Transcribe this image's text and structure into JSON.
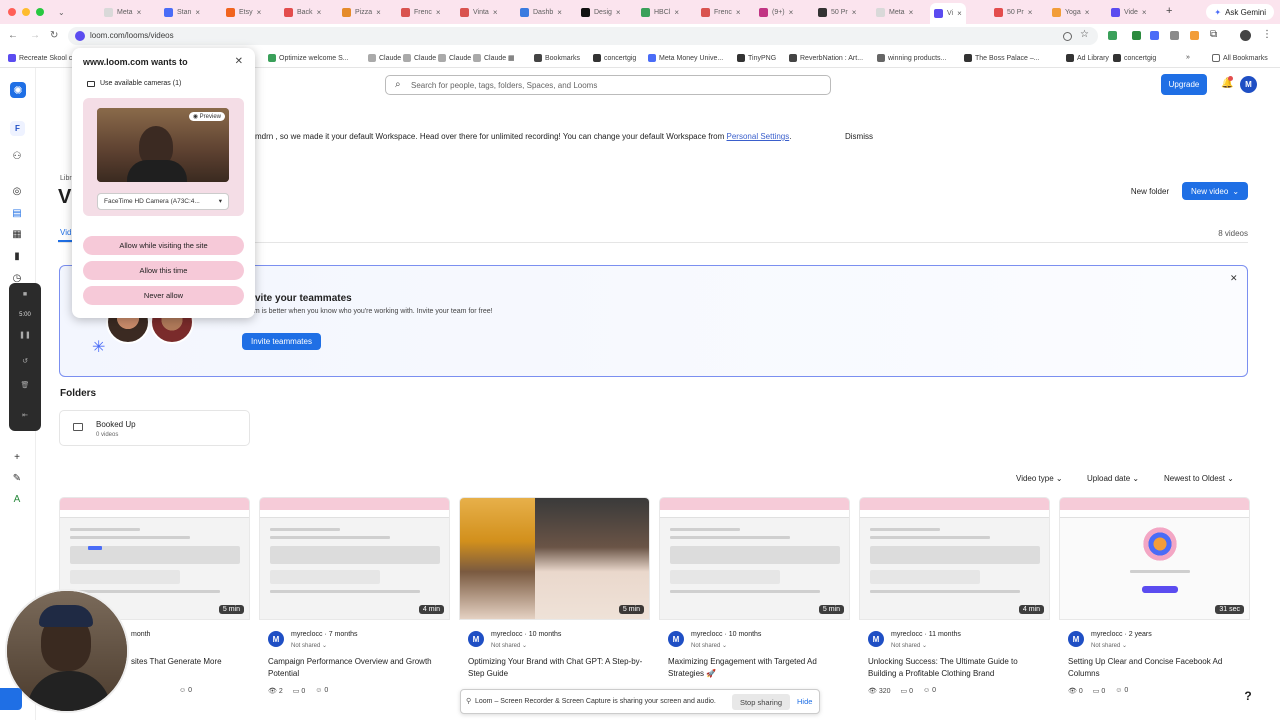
{
  "browser": {
    "tabs": [
      {
        "label": "Meta",
        "color": "#d9d9d9"
      },
      {
        "label": "Stan",
        "color": "#4a6cf7"
      },
      {
        "label": "Etsy",
        "color": "#f1641e"
      },
      {
        "label": "Back",
        "color": "#e34d4d"
      },
      {
        "label": "Pizza",
        "color": "#e58b2a"
      },
      {
        "label": "Frenc",
        "color": "#d9534f"
      },
      {
        "label": "Vinta",
        "color": "#d9534f"
      },
      {
        "label": "Dashb",
        "color": "#3a7be0"
      },
      {
        "label": "Desig",
        "color": "#111111"
      },
      {
        "label": "HBCl",
        "color": "#3aa05a"
      },
      {
        "label": "Frenc",
        "color": "#d9534f"
      },
      {
        "label": "(9+)",
        "color": "#c13584"
      },
      {
        "label": "50 Pr",
        "color": "#333333"
      },
      {
        "label": "Meta",
        "color": "#d9d9d9"
      },
      {
        "label": "Vi",
        "color": "#5b4cf0"
      },
      {
        "label": "50 Pr",
        "color": "#e34d4d"
      },
      {
        "label": "Yoga",
        "color": "#f29d38"
      },
      {
        "label": "Vide",
        "color": "#5b4cf0"
      }
    ],
    "ask_gemini": "Ask Gemini",
    "url": "loom.com/looms/videos",
    "bookmarks": [
      "Recreate Skool c...",
      "Optimize welcome S...",
      "Claude",
      "Claude",
      "Claude",
      "Claude",
      "Bookmarks",
      "concertgig",
      "Meta Money Unive...",
      "TinyPNG",
      "ReverbNation : Art...",
      "winning products...",
      "The Boss Palace –...",
      "Ad Library",
      "concertgig"
    ],
    "all_bookmarks": "All Bookmarks"
  },
  "permission": {
    "title": "www.loom.com wants to",
    "camera_line": "Use available cameras (1)",
    "preview_badge": "Preview",
    "camera_select": "FaceTime HD Camera (A73C:4...",
    "buttons": [
      "Allow while visiting the site",
      "Allow this time",
      "Never allow"
    ]
  },
  "app": {
    "search_placeholder": "Search for people, tags, folders, Spaces, and Looms",
    "upgrade": "Upgrade",
    "user_initial": "M",
    "workspace_initial": "F",
    "banner": {
      "text_a": "mdrn , so we made it your default Workspace. Head over there for unlimited recording! You can change your default Workspace from",
      "link": "Personal Settings",
      "text_b": ".",
      "dismiss": "Dismiss"
    },
    "library_crumb": "Libr",
    "page_title": "V",
    "tab_videos": "Vid",
    "new_folder": "New folder",
    "new_video": "New video",
    "video_count": "8 videos",
    "invite": {
      "title": "vite your teammates",
      "subtitle": "om is better when you know who you're working with. Invite your team for free!",
      "button": "Invite teammates"
    },
    "folders_heading": "Folders",
    "folder": {
      "name": "Booked Up",
      "count": "0 videos"
    },
    "filters": [
      "Video type",
      "Upload date",
      "Newest to Oldest"
    ],
    "recorder_time": "5:00",
    "videos": [
      {
        "owner": "",
        "shared": "",
        "age": "month",
        "title": "sites That Generate More",
        "duration": "5 min",
        "views": "",
        "comments": "",
        "reactions": "0"
      },
      {
        "owner": "myreclocc",
        "shared": "Not shared",
        "age": "7 months",
        "title": "Campaign Performance Overview and Growth Potential",
        "duration": "4 min",
        "views": "2",
        "comments": "0",
        "reactions": "0"
      },
      {
        "owner": "myreclocc",
        "shared": "Not shared",
        "age": "10 months",
        "title": "Optimizing Your Brand with Chat GPT: A Step-by-Step Guide",
        "duration": "5 min",
        "views": "",
        "comments": "",
        "reactions": ""
      },
      {
        "owner": "myreclocc",
        "shared": "Not shared",
        "age": "10 months",
        "title": "Maximizing Engagement with Targeted Ad Strategies 🚀",
        "duration": "5 min",
        "views": "",
        "comments": "",
        "reactions": ""
      },
      {
        "owner": "myreclocc",
        "shared": "Not shared",
        "age": "11 months",
        "title": "Unlocking Success: The Ultimate Guide to Building a Profitable Clothing Brand",
        "duration": "4 min",
        "views": "320",
        "comments": "0",
        "reactions": "0"
      },
      {
        "owner": "myreclocc",
        "shared": "Not shared",
        "age": "2 years",
        "title": "Setting Up Clear and Concise Facebook Ad Columns",
        "duration": "31 sec",
        "views": "0",
        "comments": "0",
        "reactions": "0"
      }
    ],
    "sharebar": {
      "text": "Loom – Screen Recorder & Screen Capture is sharing your screen and audio.",
      "stop": "Stop sharing",
      "hide": "Hide"
    },
    "help": "?"
  }
}
